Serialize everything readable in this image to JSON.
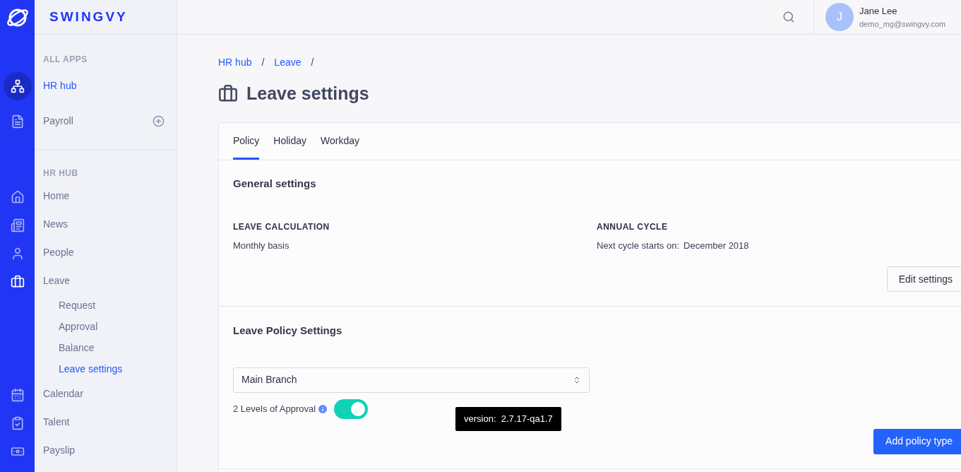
{
  "brand": {
    "name": "SWINGVY"
  },
  "user": {
    "initial": "J",
    "name": "Jane Lee",
    "email": "demo_mg@swingvy.com"
  },
  "rail": [
    {
      "kind": "hub",
      "selected": true
    },
    {
      "kind": "payroll",
      "selected": false
    },
    {
      "kind": "home",
      "selected": false
    },
    {
      "kind": "news",
      "selected": false
    },
    {
      "kind": "people",
      "selected": false
    },
    {
      "kind": "leave",
      "selected": true
    },
    {
      "kind": "calendar",
      "selected": false
    },
    {
      "kind": "talent",
      "selected": false
    },
    {
      "kind": "payslip",
      "selected": false
    }
  ],
  "sidebar": {
    "sections": [
      {
        "heading": "ALL APPS",
        "items": [
          {
            "label": "HR hub",
            "selected": true,
            "addable": false
          },
          {
            "label": "Payroll",
            "selected": false,
            "addable": true
          }
        ]
      },
      {
        "heading": "HR HUB",
        "items": [
          {
            "label": "Home",
            "selected": false
          },
          {
            "label": "News",
            "selected": false
          },
          {
            "label": "People",
            "selected": false
          },
          {
            "label": "Leave",
            "selected": false,
            "children": [
              {
                "label": "Request",
                "selected": false
              },
              {
                "label": "Approval",
                "selected": false
              },
              {
                "label": "Balance",
                "selected": false
              },
              {
                "label": "Leave settings",
                "selected": true
              }
            ]
          },
          {
            "label": "Calendar",
            "selected": false
          },
          {
            "label": "Talent",
            "selected": false
          },
          {
            "label": "Payslip",
            "selected": false
          }
        ]
      }
    ]
  },
  "breadcrumb": {
    "items": [
      "HR hub",
      "Leave"
    ],
    "separator": "/"
  },
  "page_title": "Leave settings",
  "tabs": [
    {
      "label": "Policy",
      "selected": true
    },
    {
      "label": "Holiday",
      "selected": false
    },
    {
      "label": "Workday",
      "selected": false
    }
  ],
  "general_settings": {
    "title": "General settings",
    "fields": [
      {
        "label": "LEAVE CALCULATION",
        "value": "Monthly basis"
      },
      {
        "label": "ANNUAL CYCLE",
        "prefix": "Next cycle starts on:",
        "value": "December 2018"
      }
    ],
    "button": "Edit settings"
  },
  "policy_settings": {
    "title": "Leave Policy Settings",
    "branch": "Main Branch",
    "approval": {
      "label": "2 Levels of Approval",
      "on": true
    },
    "button": "Add policy type"
  },
  "tooltip": "version:  2.7.17-qa1.7"
}
